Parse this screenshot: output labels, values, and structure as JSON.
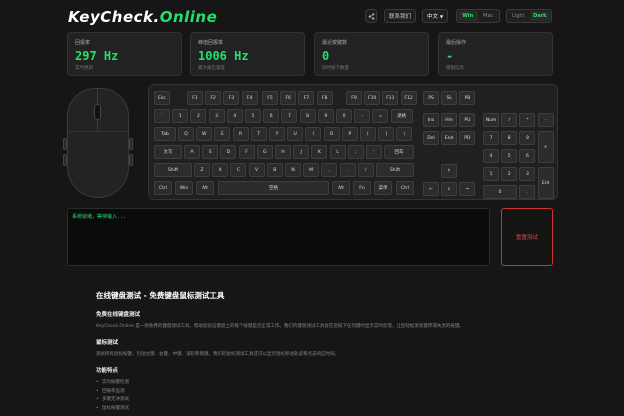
{
  "header": {
    "logo_main": "KeyCheck.",
    "logo_accent": "Online",
    "share_icon": "share-icon",
    "contact_label": "联系我们",
    "language_label": "中文",
    "os_options": [
      "Win",
      "Mac"
    ],
    "os_selected": "Win",
    "theme_options": [
      "Light",
      "Dark"
    ],
    "theme_selected": "Dark"
  },
  "stats": [
    {
      "label": "回报率",
      "value": "297 Hz",
      "sub": "实时更新"
    },
    {
      "label": "峰值回报率",
      "value": "1006 Hz",
      "sub": "最大报告速度"
    },
    {
      "label": "最近按键数",
      "value": "0",
      "sub": "同时按下数量"
    },
    {
      "label": "最后操作",
      "value": "-",
      "sub": "键鼠信息"
    }
  ],
  "keyboard": {
    "row_fn": [
      "Esc",
      "F1",
      "F2",
      "F3",
      "F4",
      "F5",
      "F6",
      "F7",
      "F8",
      "F9",
      "F10",
      "F11",
      "F12"
    ],
    "row_num": [
      "`",
      "1",
      "2",
      "3",
      "4",
      "5",
      "6",
      "7",
      "8",
      "9",
      "0",
      "-",
      "=",
      "退格"
    ],
    "row_tab": [
      "Tab",
      "Q",
      "W",
      "E",
      "R",
      "T",
      "Y",
      "U",
      "I",
      "O",
      "P",
      "[",
      "]",
      "\\"
    ],
    "row_caps": [
      "大写",
      "A",
      "S",
      "D",
      "F",
      "G",
      "H",
      "J",
      "K",
      "L",
      ";",
      "'",
      "回车"
    ],
    "row_shift": [
      "Shift",
      "Z",
      "X",
      "C",
      "V",
      "B",
      "N",
      "M",
      ",",
      ".",
      "/",
      "Shift"
    ],
    "row_ctrl": [
      "Ctrl",
      "Win",
      "Alt",
      "空格",
      "Alt",
      "Fn",
      "菜单",
      "Ctrl"
    ],
    "sys_keys": [
      "PS",
      "SL",
      "PB"
    ],
    "nav_keys": [
      "Ins",
      "Hm",
      "PU",
      "Del",
      "End",
      "PD"
    ],
    "arrows": [
      "↑",
      "←",
      "↓",
      "→"
    ],
    "numpad": [
      "Num",
      "/",
      "*",
      "-",
      "7",
      "8",
      "9",
      "+",
      "4",
      "5",
      "6",
      "1",
      "2",
      "3",
      "Ent",
      "0",
      "."
    ]
  },
  "log": {
    "line": "系统就绪，等待输入..."
  },
  "reset_label": "重置测试",
  "article": {
    "title": "在线键盘测试 - 免费键盘鼠标测试工具",
    "s1_title": "免费在线键盘测试",
    "s1_text": "KeyCheck.Online 是一款免费的键盘测试工具，帮助您验证键盘上的每个按键是否正常工作。我们的键盘测试工具会在您按下任何键时显示实时反馈，让您轻松发现键序或失灵的按键。",
    "s2_title": "鼠标测试",
    "s2_text": "测试所有鼠标按键，包括左键、右键、中键、滚轮和侧键。我们的鼠标测试工具还可以显示鼠标移动轨迹和点击响应时间。",
    "s3_title": "功能特点",
    "features": [
      "实时按键检测",
      "回报率监测",
      "多键无冲测试",
      "鼠标按键测试"
    ]
  },
  "colors": {
    "accent": "#22e06a",
    "danger": "#e04545",
    "bg": "#161616"
  }
}
